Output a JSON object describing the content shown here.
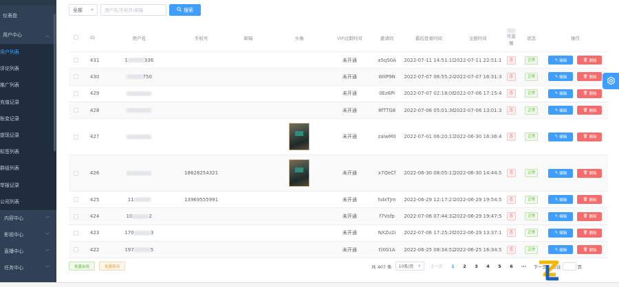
{
  "sidebar": {
    "items": [
      {
        "label": "仪表盘"
      },
      {
        "label": "用户中心",
        "expanded": true
      }
    ],
    "sub_items": [
      {
        "label": "用户列表",
        "active": true
      },
      {
        "label": "评论列表"
      },
      {
        "label": "推广列表"
      },
      {
        "label": "充值记录"
      },
      {
        "label": "账变记录"
      },
      {
        "label": "提现记录"
      },
      {
        "label": "标签列表"
      },
      {
        "label": "群组列表"
      },
      {
        "label": "举报记录"
      },
      {
        "label": "公司列表"
      }
    ],
    "groups": [
      {
        "label": "内容中心"
      },
      {
        "label": "影视中心"
      },
      {
        "label": "直播中心"
      },
      {
        "label": "任务中心"
      }
    ]
  },
  "toolbar": {
    "filter_value": "全部",
    "search_placeholder": "用户名/手机号/邮箱",
    "search_label": "搜索"
  },
  "table": {
    "headers": {
      "id": "ID",
      "username": "用户名",
      "phone": "手机号",
      "email": "邮箱",
      "avatar": "头像",
      "vip": "VIP过期时间",
      "invite": "邀请码",
      "last_login": "最后登录时间",
      "register": "注册时间",
      "live_1": "可直",
      "live_2": "播",
      "status": "状态",
      "ops": "操作"
    },
    "rows": [
      {
        "id": "431",
        "user_prefix": "1",
        "user_suffix": "336",
        "phone": "",
        "vip": "未开通",
        "code": "a5qS0A",
        "login": "2022-07-11 14:51:10",
        "reg": "2022-07-11 22:51:10",
        "live": "否",
        "status": "正常",
        "avatar": false
      },
      {
        "id": "430",
        "user_prefix": "",
        "user_suffix": "750",
        "phone": "",
        "vip": "未开通",
        "code": "WilP9N",
        "login": "2022-07-07 08:55:24",
        "reg": "2022-07-07 16:31:30",
        "live": "否",
        "status": "正常",
        "avatar": false
      },
      {
        "id": "429",
        "user_prefix": "",
        "user_suffix": "",
        "phone": "",
        "vip": "未开通",
        "code": "0Ez8Pi",
        "login": "2022-07-07 02:18:08",
        "reg": "2022-07-06 17:15:42",
        "live": "否",
        "status": "正常",
        "avatar": false
      },
      {
        "id": "428",
        "user_prefix": "",
        "user_suffix": "",
        "phone": "",
        "vip": "未开通",
        "code": "8fTTG8",
        "login": "2022-07-06 05:01:36",
        "reg": "2022-07-06 13:01:36",
        "live": "否",
        "status": "正常",
        "avatar": false
      },
      {
        "id": "427",
        "user_prefix": "",
        "user_suffix": "",
        "phone": "",
        "vip": "未开通",
        "code": "zalwM0",
        "login": "2022-07-01 06:20:13",
        "reg": "2022-06-30 16:36:43",
        "live": "否",
        "status": "正常",
        "avatar": true
      },
      {
        "id": "426",
        "user_prefix": "",
        "user_suffix": "",
        "phone": "18628254321",
        "vip": "未开通",
        "code": "x7QeCf",
        "login": "2022-06-30 08:05:13",
        "reg": "2022-06-30 14:44:58",
        "live": "否",
        "status": "正常",
        "avatar": true
      },
      {
        "id": "425",
        "user_prefix": "11",
        "user_suffix": "",
        "phone": "13969555991",
        "vip": "未开通",
        "code": "hdxTJm",
        "login": "2022-06-29 12:17:27",
        "reg": "2022-06-29 19:54:56",
        "live": "否",
        "status": "正常",
        "avatar": false
      },
      {
        "id": "424",
        "user_prefix": "10",
        "user_suffix": "2",
        "phone": "",
        "vip": "未开通",
        "code": "f7Vsfp",
        "login": "2022-07-06 07:44:32",
        "reg": "2022-06-29 19:47:56",
        "live": "否",
        "status": "正常",
        "avatar": false
      },
      {
        "id": "423",
        "user_prefix": "170",
        "user_suffix": "3",
        "phone": "",
        "vip": "未开通",
        "code": "NXZu2i",
        "login": "2022-07-06 17:25:26",
        "reg": "2022-06-29 13:37:11",
        "live": "否",
        "status": "正常",
        "avatar": false
      },
      {
        "id": "422",
        "user_prefix": "197",
        "user_suffix": "5",
        "phone": "",
        "vip": "未开通",
        "code": "tlXG1A",
        "login": "2022-06-25 08:34:52",
        "reg": "2022-06-25 16:34:52",
        "live": "否",
        "status": "正常",
        "avatar": false
      }
    ],
    "edit_label": "编辑",
    "delete_label": "删除"
  },
  "footer": {
    "bulk_enable": "批量启用",
    "bulk_disable": "批量禁用",
    "total": "共 407 条",
    "page_size": "10条/页",
    "prev": "上一页",
    "pages": [
      "1",
      "2",
      "3",
      "4",
      "5",
      "6"
    ],
    "more": "···",
    "next": "下一页",
    "goto_prefix": "前往",
    "goto_suffix": "页"
  },
  "colors": {
    "primary": "#409eff",
    "danger": "#f56c6c",
    "success": "#67c23a",
    "warning": "#e6a23c",
    "sidebar_bg": "#304156"
  }
}
